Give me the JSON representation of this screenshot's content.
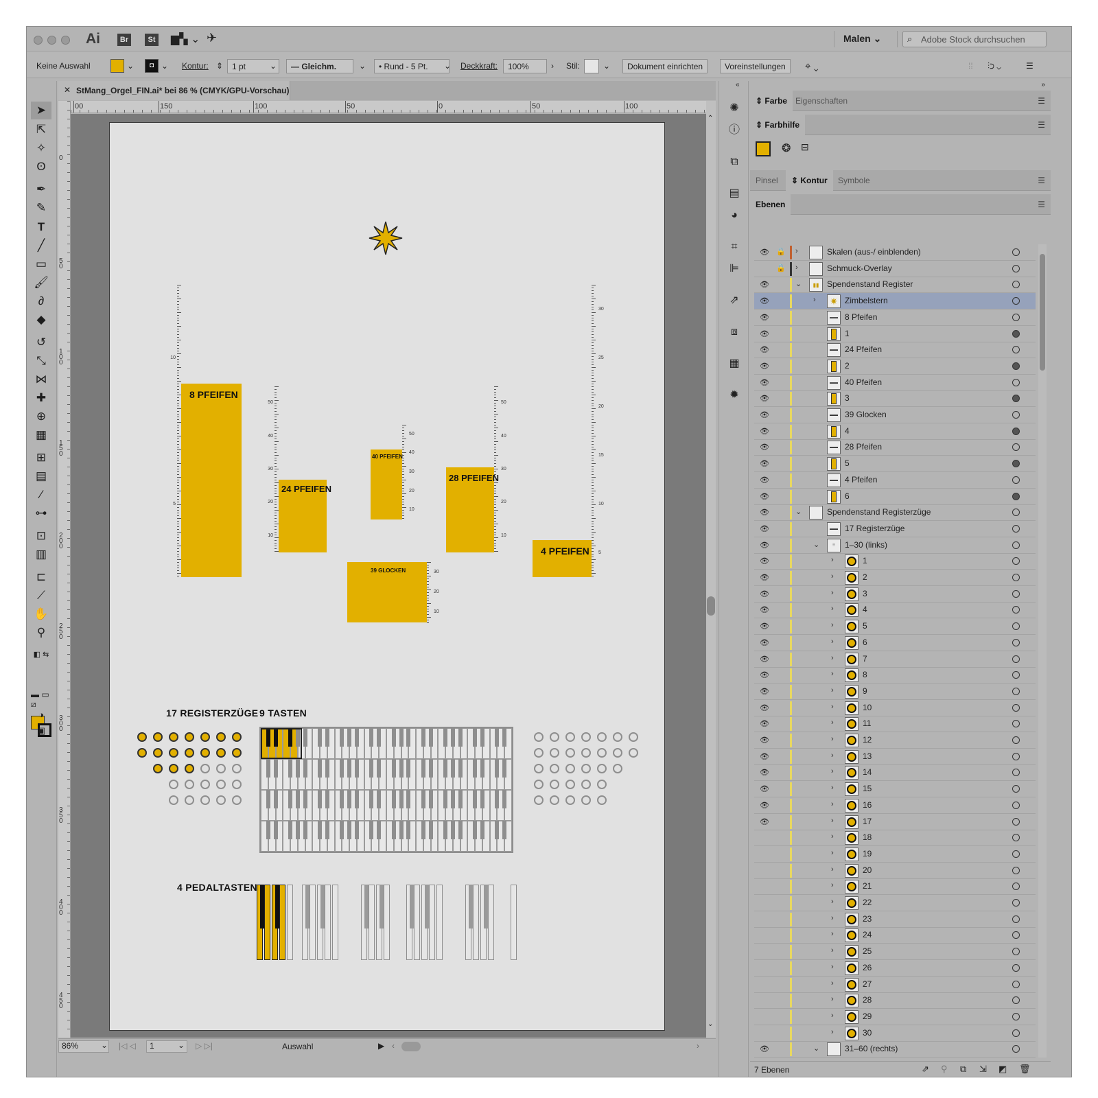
{
  "app": {
    "name": "Ai",
    "bridge": "Br",
    "stock": "St",
    "workspace": "Malen",
    "search_placeholder": "Adobe Stock durchsuchen"
  },
  "control_bar": {
    "selection": "Keine Auswahl",
    "stroke_label": "Kontur:",
    "stroke_weight": "1 pt",
    "stroke_profile": "Gleichm.",
    "brush": "Rund - 5 Pt.",
    "opacity_label": "Deckkraft:",
    "opacity": "100%",
    "style_label": "Stil:",
    "doc_setup": "Dokument einrichten",
    "preferences": "Voreinstellungen"
  },
  "document": {
    "tab": "StMang_Orgel_FIN.ai* bei 86 % (CMYK/GPU-Vorschau)"
  },
  "ruler_top": [
    "00",
    "150",
    "100",
    "50",
    "0",
    "50",
    "100"
  ],
  "ruler_left": [
    "0",
    "50",
    "100",
    "150",
    "200",
    "250",
    "300",
    "350",
    "400",
    "450"
  ],
  "status": {
    "zoom": "86%",
    "page": "1",
    "mode": "Auswahl"
  },
  "artwork": {
    "bars": [
      {
        "label": "8 PFEIFEN",
        "value": 8
      },
      {
        "label": "24 PFEIFEN",
        "value": 24
      },
      {
        "label": "40 PFEIFEN",
        "value": 40
      },
      {
        "label": "39 GLOCKEN",
        "value": 39
      },
      {
        "label": "28 PFEIFEN",
        "value": 28
      },
      {
        "label": "4 PFEIFEN",
        "value": 4
      }
    ],
    "scale_a": [
      "10",
      "5"
    ],
    "scale_b": [
      "50",
      "40",
      "30",
      "20",
      "10"
    ],
    "scale_c": [
      "50",
      "40",
      "30",
      "20",
      "10"
    ],
    "scale_d": [
      "30",
      "20",
      "10"
    ],
    "scale_e": [
      "50",
      "40",
      "30",
      "20",
      "10"
    ],
    "scale_f": [
      "30",
      "25",
      "20",
      "15",
      "10",
      "5"
    ],
    "registers_heading": "17 REGISTERZÜGE",
    "registers_filled": 17,
    "keys_heading": "9 TASTEN",
    "keys_filled": 9,
    "pedals_heading": "4 PEDALTASTEN",
    "pedals_filled": 4
  },
  "panels": {
    "tab_farbe": "Farbe",
    "tab_eigenschaften": "Eigenschaften",
    "tab_farbhilfe": "Farbhilfe",
    "tab_pinsel": "Pinsel",
    "tab_kontur": "Kontur",
    "tab_symbole": "Symbole",
    "tab_ebenen": "Ebenen",
    "layer_count": "7 Ebenen"
  },
  "layers": [
    {
      "name": "Skalen (aus-/ einblenden)",
      "level": 0,
      "twirl": ">",
      "eye": true,
      "lock": true,
      "color": "#c06030",
      "thumb": "blank",
      "target": false
    },
    {
      "name": "Schmuck-Overlay",
      "level": 0,
      "twirl": ">",
      "eye": false,
      "lock": true,
      "color": "#333333",
      "thumb": "blank",
      "target": false
    },
    {
      "name": "Spendenstand Register",
      "level": 0,
      "twirl": "v",
      "eye": true,
      "lock": false,
      "color": "#e8d860",
      "thumb": "bars",
      "target": false
    },
    {
      "name": "Zimbelstern",
      "level": 1,
      "twirl": ">",
      "eye": true,
      "lock": false,
      "color": "#e8d860",
      "thumb": "star",
      "target": false,
      "selected": true
    },
    {
      "name": "8 Pfeifen",
      "level": 1,
      "twirl": "",
      "eye": true,
      "lock": false,
      "color": "#e8d860",
      "thumb": "text",
      "target": false
    },
    {
      "name": "1",
      "level": 1,
      "twirl": "",
      "eye": true,
      "lock": false,
      "color": "#e8d860",
      "thumb": "bar",
      "target": true
    },
    {
      "name": "24 Pfeifen",
      "level": 1,
      "twirl": "",
      "eye": true,
      "lock": false,
      "color": "#e8d860",
      "thumb": "text",
      "target": false
    },
    {
      "name": "2",
      "level": 1,
      "twirl": "",
      "eye": true,
      "lock": false,
      "color": "#e8d860",
      "thumb": "bar",
      "target": true
    },
    {
      "name": "40 Pfeifen",
      "level": 1,
      "twirl": "",
      "eye": true,
      "lock": false,
      "color": "#e8d860",
      "thumb": "text",
      "target": false
    },
    {
      "name": "3",
      "level": 1,
      "twirl": "",
      "eye": true,
      "lock": false,
      "color": "#e8d860",
      "thumb": "bar",
      "target": true
    },
    {
      "name": "39 Glocken",
      "level": 1,
      "twirl": "",
      "eye": true,
      "lock": false,
      "color": "#e8d860",
      "thumb": "text",
      "target": false
    },
    {
      "name": "4",
      "level": 1,
      "twirl": "",
      "eye": true,
      "lock": false,
      "color": "#e8d860",
      "thumb": "bar",
      "target": true
    },
    {
      "name": "28 Pfeifen",
      "level": 1,
      "twirl": "",
      "eye": true,
      "lock": false,
      "color": "#e8d860",
      "thumb": "text",
      "target": false
    },
    {
      "name": "5",
      "level": 1,
      "twirl": "",
      "eye": true,
      "lock": false,
      "color": "#e8d860",
      "thumb": "bar",
      "target": true
    },
    {
      "name": "4 Pfeifen",
      "level": 1,
      "twirl": "",
      "eye": true,
      "lock": false,
      "color": "#e8d860",
      "thumb": "text",
      "target": false
    },
    {
      "name": "6",
      "level": 1,
      "twirl": "",
      "eye": true,
      "lock": false,
      "color": "#e8d860",
      "thumb": "bar",
      "target": true
    },
    {
      "name": "Spendenstand Registerzüge",
      "level": 0,
      "twirl": "v",
      "eye": true,
      "lock": false,
      "color": "#e8d860",
      "thumb": "blank",
      "target": false
    },
    {
      "name": "17 Registerzüge",
      "level": 1,
      "twirl": "",
      "eye": true,
      "lock": false,
      "color": "#e8d860",
      "thumb": "text",
      "target": false
    },
    {
      "name": "1–30 (links)",
      "level": 1,
      "twirl": "v",
      "eye": true,
      "lock": false,
      "color": "#e8d860",
      "thumb": "dots",
      "target": false
    },
    {
      "name": "1",
      "level": 2,
      "twirl": ">",
      "eye": true,
      "lock": false,
      "color": "#e8d860",
      "thumb": "circle",
      "target": false
    },
    {
      "name": "2",
      "level": 2,
      "twirl": ">",
      "eye": true,
      "lock": false,
      "color": "#e8d860",
      "thumb": "circle",
      "target": false
    },
    {
      "name": "3",
      "level": 2,
      "twirl": ">",
      "eye": true,
      "lock": false,
      "color": "#e8d860",
      "thumb": "circle",
      "target": false
    },
    {
      "name": "4",
      "level": 2,
      "twirl": ">",
      "eye": true,
      "lock": false,
      "color": "#e8d860",
      "thumb": "circle",
      "target": false
    },
    {
      "name": "5",
      "level": 2,
      "twirl": ">",
      "eye": true,
      "lock": false,
      "color": "#e8d860",
      "thumb": "circle",
      "target": false
    },
    {
      "name": "6",
      "level": 2,
      "twirl": ">",
      "eye": true,
      "lock": false,
      "color": "#e8d860",
      "thumb": "circle",
      "target": false
    },
    {
      "name": "7",
      "level": 2,
      "twirl": ">",
      "eye": true,
      "lock": false,
      "color": "#e8d860",
      "thumb": "circle",
      "target": false
    },
    {
      "name": "8",
      "level": 2,
      "twirl": ">",
      "eye": true,
      "lock": false,
      "color": "#e8d860",
      "thumb": "circle",
      "target": false
    },
    {
      "name": "9",
      "level": 2,
      "twirl": ">",
      "eye": true,
      "lock": false,
      "color": "#e8d860",
      "thumb": "circle",
      "target": false
    },
    {
      "name": "10",
      "level": 2,
      "twirl": ">",
      "eye": true,
      "lock": false,
      "color": "#e8d860",
      "thumb": "circle",
      "target": false
    },
    {
      "name": "11",
      "level": 2,
      "twirl": ">",
      "eye": true,
      "lock": false,
      "color": "#e8d860",
      "thumb": "circle",
      "target": false
    },
    {
      "name": "12",
      "level": 2,
      "twirl": ">",
      "eye": true,
      "lock": false,
      "color": "#e8d860",
      "thumb": "circle",
      "target": false
    },
    {
      "name": "13",
      "level": 2,
      "twirl": ">",
      "eye": true,
      "lock": false,
      "color": "#e8d860",
      "thumb": "circle",
      "target": false
    },
    {
      "name": "14",
      "level": 2,
      "twirl": ">",
      "eye": true,
      "lock": false,
      "color": "#e8d860",
      "thumb": "circle",
      "target": false
    },
    {
      "name": "15",
      "level": 2,
      "twirl": ">",
      "eye": true,
      "lock": false,
      "color": "#e8d860",
      "thumb": "circle",
      "target": false
    },
    {
      "name": "16",
      "level": 2,
      "twirl": ">",
      "eye": true,
      "lock": false,
      "color": "#e8d860",
      "thumb": "circle",
      "target": false
    },
    {
      "name": "17",
      "level": 2,
      "twirl": ">",
      "eye": true,
      "lock": false,
      "color": "#e8d860",
      "thumb": "circle",
      "target": false
    },
    {
      "name": "18",
      "level": 2,
      "twirl": ">",
      "eye": false,
      "lock": false,
      "color": "#e8d860",
      "thumb": "circle",
      "target": false
    },
    {
      "name": "19",
      "level": 2,
      "twirl": ">",
      "eye": false,
      "lock": false,
      "color": "#e8d860",
      "thumb": "circle",
      "target": false
    },
    {
      "name": "20",
      "level": 2,
      "twirl": ">",
      "eye": false,
      "lock": false,
      "color": "#e8d860",
      "thumb": "circle",
      "target": false
    },
    {
      "name": "21",
      "level": 2,
      "twirl": ">",
      "eye": false,
      "lock": false,
      "color": "#e8d860",
      "thumb": "circle",
      "target": false
    },
    {
      "name": "22",
      "level": 2,
      "twirl": ">",
      "eye": false,
      "lock": false,
      "color": "#e8d860",
      "thumb": "circle",
      "target": false
    },
    {
      "name": "23",
      "level": 2,
      "twirl": ">",
      "eye": false,
      "lock": false,
      "color": "#e8d860",
      "thumb": "circle",
      "target": false
    },
    {
      "name": "24",
      "level": 2,
      "twirl": ">",
      "eye": false,
      "lock": false,
      "color": "#e8d860",
      "thumb": "circle",
      "target": false
    },
    {
      "name": "25",
      "level": 2,
      "twirl": ">",
      "eye": false,
      "lock": false,
      "color": "#e8d860",
      "thumb": "circle",
      "target": false
    },
    {
      "name": "26",
      "level": 2,
      "twirl": ">",
      "eye": false,
      "lock": false,
      "color": "#e8d860",
      "thumb": "circle",
      "target": false
    },
    {
      "name": "27",
      "level": 2,
      "twirl": ">",
      "eye": false,
      "lock": false,
      "color": "#e8d860",
      "thumb": "circle",
      "target": false
    },
    {
      "name": "28",
      "level": 2,
      "twirl": ">",
      "eye": false,
      "lock": false,
      "color": "#e8d860",
      "thumb": "circle",
      "target": false
    },
    {
      "name": "29",
      "level": 2,
      "twirl": ">",
      "eye": false,
      "lock": false,
      "color": "#e8d860",
      "thumb": "circle",
      "target": false
    },
    {
      "name": "30",
      "level": 2,
      "twirl": ">",
      "eye": false,
      "lock": false,
      "color": "#e8d860",
      "thumb": "circle",
      "target": false
    },
    {
      "name": "31–60 (rechts)",
      "level": 1,
      "twirl": "v",
      "eye": true,
      "lock": false,
      "color": "#e8d860",
      "thumb": "blank",
      "target": false
    }
  ]
}
